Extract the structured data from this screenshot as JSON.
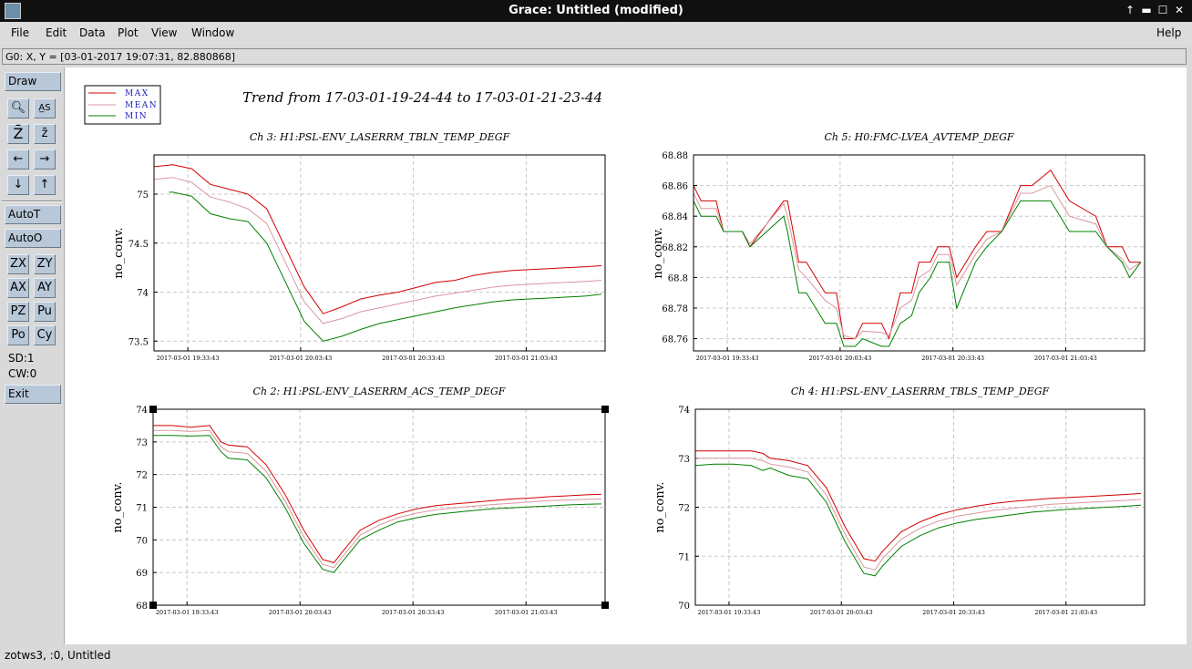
{
  "window": {
    "title": "Grace: Untitled (modified)",
    "controls": [
      "↑",
      "▬",
      "☐",
      "✕"
    ]
  },
  "menu": {
    "items": [
      "File",
      "Edit",
      "Data",
      "Plot",
      "View",
      "Window"
    ],
    "help": "Help"
  },
  "locator": "G0: X, Y = [03-01-2017 19:07:31, 82.880868]",
  "toolbox": {
    "draw": "Draw",
    "autot": "AutoT",
    "autoo": "AutoO",
    "zx": "ZX",
    "zy": "ZY",
    "ax": "AX",
    "ay": "AY",
    "pz": "PZ",
    "pu": "Pu",
    "po": "Po",
    "cy": "Cy",
    "sd": "SD:1",
    "cw": "CW:0",
    "exit": "Exit"
  },
  "status": "zotws3, :0, Untitled",
  "legend": {
    "entries": [
      {
        "name": "MAX",
        "color": "#d40000"
      },
      {
        "name": "MEAN",
        "color": "#d898a0"
      },
      {
        "name": "MIN",
        "color": "#008000"
      }
    ]
  },
  "plot_title": "Trend from 17-03-01-19-24-44 to 17-03-01-21-23-44",
  "chart_data": [
    {
      "type": "line",
      "title": "Ch 3: H1:PSL-ENV_LASERRM_TBLN_TEMP_DEGF",
      "ylabel": "no_conv.",
      "ylim": [
        73.4,
        75.4
      ],
      "yticks": [
        "75",
        "74.5",
        "74",
        "73.5"
      ],
      "xticks": [
        "2017-03-01 19:33:43",
        "2017-03-01 20:03:43",
        "2017-03-01 20:33:43",
        "2017-03-01 21:03:43"
      ],
      "series": [
        {
          "name": "MAX",
          "x": [
            0,
            5,
            10,
            15,
            20,
            25,
            30,
            35,
            40,
            45,
            50,
            55,
            60,
            65,
            70,
            75,
            80,
            85,
            90,
            95,
            100,
            105,
            110,
            115,
            119
          ],
          "values": [
            75.28,
            75.3,
            75.26,
            75.1,
            75.05,
            75.0,
            74.85,
            74.45,
            74.05,
            73.78,
            73.85,
            73.93,
            73.97,
            74.0,
            74.05,
            74.1,
            74.12,
            74.17,
            74.2,
            74.22,
            74.23,
            74.24,
            74.25,
            74.26,
            74.27
          ]
        },
        {
          "name": "MEAN",
          "x": [
            0,
            5,
            10,
            15,
            20,
            25,
            30,
            35,
            40,
            45,
            50,
            55,
            60,
            65,
            70,
            75,
            80,
            85,
            90,
            95,
            100,
            105,
            110,
            115,
            119
          ],
          "values": [
            75.15,
            75.17,
            75.12,
            74.97,
            74.92,
            74.85,
            74.7,
            74.3,
            73.9,
            73.68,
            73.73,
            73.8,
            73.84,
            73.88,
            73.92,
            73.96,
            73.99,
            74.02,
            74.05,
            74.07,
            74.08,
            74.09,
            74.1,
            74.11,
            74.12
          ]
        },
        {
          "name": "MIN",
          "x": [
            4,
            5,
            10,
            15,
            20,
            25,
            30,
            35,
            40,
            45,
            50,
            55,
            60,
            65,
            70,
            75,
            80,
            85,
            90,
            95,
            100,
            105,
            110,
            115,
            119
          ],
          "values": [
            75.02,
            75.02,
            74.98,
            74.8,
            74.75,
            74.72,
            74.5,
            74.1,
            73.7,
            73.5,
            73.55,
            73.62,
            73.68,
            73.72,
            73.76,
            73.8,
            73.84,
            73.87,
            73.9,
            73.92,
            73.93,
            73.94,
            73.95,
            73.96,
            73.98
          ]
        }
      ]
    },
    {
      "type": "line",
      "title": "Ch 5: H0:FMC-LVEA_AVTEMP_DEGF",
      "ylabel": "no_conv.",
      "ylim": [
        68.752,
        68.88
      ],
      "yticks": [
        "68.88",
        "68.86",
        "68.84",
        "68.82",
        "68.8",
        "68.78",
        "68.76"
      ],
      "xticks": [
        "2017-03-01 19:33:43",
        "2017-03-01 20:03:43",
        "2017-03-01 20:33:43",
        "2017-03-01 21:03:43"
      ],
      "series": [
        {
          "name": "MAX",
          "x": [
            0,
            2,
            6,
            8,
            13,
            15,
            24,
            25,
            28,
            30,
            35,
            38,
            40,
            43,
            45,
            50,
            52,
            55,
            58,
            60,
            63,
            65,
            68,
            70,
            75,
            78,
            82,
            87,
            90,
            95,
            100,
            107,
            110,
            114,
            116,
            119
          ],
          "values": [
            68.86,
            68.85,
            68.85,
            68.83,
            68.83,
            68.82,
            68.85,
            68.85,
            68.81,
            68.81,
            68.79,
            68.79,
            68.76,
            68.76,
            68.77,
            68.77,
            68.76,
            68.79,
            68.79,
            68.81,
            68.81,
            68.82,
            68.82,
            68.8,
            68.82,
            68.83,
            68.83,
            68.86,
            68.86,
            68.87,
            68.85,
            68.84,
            68.82,
            68.82,
            68.81,
            68.81
          ]
        },
        {
          "name": "MEAN",
          "x": [
            0,
            2,
            6,
            8,
            13,
            15,
            24,
            25,
            28,
            30,
            35,
            38,
            40,
            43,
            45,
            50,
            52,
            55,
            58,
            60,
            63,
            65,
            68,
            70,
            75,
            78,
            82,
            87,
            90,
            95,
            100,
            107,
            110,
            114,
            116,
            119
          ],
          "values": [
            68.855,
            68.845,
            68.845,
            68.83,
            68.83,
            68.822,
            68.848,
            68.84,
            68.805,
            68.8,
            68.785,
            68.78,
            68.762,
            68.76,
            68.765,
            68.764,
            68.762,
            68.78,
            68.785,
            68.8,
            68.805,
            68.815,
            68.815,
            68.795,
            68.815,
            68.825,
            68.83,
            68.855,
            68.855,
            68.86,
            68.84,
            68.835,
            68.82,
            68.812,
            68.805,
            68.81
          ]
        },
        {
          "name": "MIN",
          "x": [
            0,
            2,
            6,
            8,
            13,
            15,
            24,
            25,
            28,
            30,
            35,
            38,
            40,
            43,
            45,
            50,
            52,
            55,
            58,
            60,
            63,
            65,
            68,
            70,
            75,
            78,
            82,
            87,
            90,
            95,
            100,
            107,
            110,
            114,
            116,
            119
          ],
          "values": [
            68.85,
            68.84,
            68.84,
            68.83,
            68.83,
            68.82,
            68.84,
            68.83,
            68.79,
            68.79,
            68.77,
            68.77,
            68.755,
            68.755,
            68.76,
            68.755,
            68.755,
            68.77,
            68.775,
            68.79,
            68.8,
            68.81,
            68.81,
            68.78,
            68.81,
            68.82,
            68.83,
            68.85,
            68.85,
            68.85,
            68.83,
            68.83,
            68.82,
            68.81,
            68.8,
            68.81
          ]
        }
      ]
    },
    {
      "type": "line",
      "title": "Ch 2: H1:PSL-ENV_LASERRM_ACS_TEMP_DEGF",
      "ylabel": "no_conv.",
      "ylim": [
        68,
        74
      ],
      "yticks": [
        "74",
        "73",
        "72",
        "71",
        "70",
        "69",
        "68"
      ],
      "xticks": [
        "2017-03-01 19:33:43",
        "2017-03-01 20:03:43",
        "2017-03-01 20:33:43",
        "2017-03-01 21:03:43"
      ],
      "series": [
        {
          "name": "MAX",
          "x": [
            0,
            5,
            10,
            15,
            18,
            20,
            25,
            30,
            35,
            40,
            45,
            48,
            50,
            55,
            60,
            65,
            70,
            75,
            80,
            85,
            90,
            95,
            100,
            105,
            110,
            115,
            119
          ],
          "values": [
            73.5,
            73.5,
            73.45,
            73.5,
            73.0,
            72.9,
            72.85,
            72.3,
            71.4,
            70.3,
            69.4,
            69.3,
            69.6,
            70.3,
            70.6,
            70.8,
            70.95,
            71.05,
            71.1,
            71.15,
            71.2,
            71.25,
            71.28,
            71.32,
            71.35,
            71.38,
            71.4
          ]
        },
        {
          "name": "MEAN",
          "x": [
            0,
            5,
            10,
            15,
            18,
            20,
            25,
            30,
            35,
            40,
            45,
            48,
            50,
            55,
            60,
            65,
            70,
            75,
            80,
            85,
            90,
            95,
            100,
            105,
            110,
            115,
            119
          ],
          "values": [
            73.35,
            73.35,
            73.32,
            73.35,
            72.85,
            72.7,
            72.65,
            72.1,
            71.2,
            70.1,
            69.25,
            69.15,
            69.45,
            70.15,
            70.45,
            70.68,
            70.82,
            70.92,
            70.98,
            71.03,
            71.08,
            71.12,
            71.16,
            71.2,
            71.22,
            71.24,
            71.26
          ]
        },
        {
          "name": "MIN",
          "x": [
            0,
            5,
            10,
            15,
            18,
            20,
            25,
            30,
            35,
            40,
            45,
            48,
            50,
            55,
            60,
            65,
            70,
            75,
            80,
            85,
            90,
            95,
            100,
            105,
            110,
            115,
            119
          ],
          "values": [
            73.2,
            73.2,
            73.18,
            73.2,
            72.7,
            72.5,
            72.45,
            71.9,
            71.0,
            69.9,
            69.1,
            69.0,
            69.3,
            70.0,
            70.3,
            70.55,
            70.68,
            70.78,
            70.84,
            70.9,
            70.95,
            70.98,
            71.01,
            71.04,
            71.07,
            71.09,
            71.1
          ]
        }
      ]
    },
    {
      "type": "line",
      "title": "Ch 4: H1:PSL-ENV_LASERRM_TBLS_TEMP_DEGF",
      "ylabel": "no_conv.",
      "ylim": [
        70,
        74
      ],
      "yticks": [
        "74",
        "73",
        "72",
        "71",
        "70"
      ],
      "xticks": [
        "2017-03-01 19:33:43",
        "2017-03-01 20:03:43",
        "2017-03-01 20:33:43",
        "2017-03-01 21:03:43"
      ],
      "series": [
        {
          "name": "MAX",
          "x": [
            0,
            5,
            10,
            15,
            18,
            20,
            25,
            30,
            35,
            40,
            45,
            48,
            50,
            55,
            60,
            65,
            70,
            75,
            80,
            85,
            90,
            95,
            100,
            105,
            110,
            115,
            119
          ],
          "values": [
            73.15,
            73.15,
            73.15,
            73.15,
            73.1,
            73.0,
            72.95,
            72.85,
            72.4,
            71.6,
            70.95,
            70.9,
            71.1,
            71.5,
            71.7,
            71.85,
            71.95,
            72.02,
            72.08,
            72.12,
            72.15,
            72.18,
            72.2,
            72.22,
            72.24,
            72.26,
            72.28
          ]
        },
        {
          "name": "MEAN",
          "x": [
            0,
            5,
            10,
            15,
            18,
            20,
            25,
            30,
            35,
            40,
            45,
            48,
            50,
            55,
            60,
            65,
            70,
            75,
            80,
            85,
            90,
            95,
            100,
            105,
            110,
            115,
            119
          ],
          "values": [
            73.0,
            73.0,
            73.0,
            73.0,
            72.95,
            72.88,
            72.82,
            72.72,
            72.25,
            71.45,
            70.78,
            70.72,
            70.95,
            71.35,
            71.57,
            71.72,
            71.82,
            71.88,
            71.94,
            71.98,
            72.02,
            72.06,
            72.08,
            72.1,
            72.12,
            72.14,
            72.16
          ]
        },
        {
          "name": "MIN",
          "x": [
            0,
            5,
            10,
            15,
            18,
            20,
            25,
            30,
            35,
            40,
            45,
            48,
            50,
            55,
            60,
            65,
            70,
            75,
            80,
            85,
            90,
            95,
            100,
            105,
            110,
            115,
            119
          ],
          "values": [
            72.85,
            72.88,
            72.88,
            72.85,
            72.75,
            72.8,
            72.65,
            72.58,
            72.1,
            71.3,
            70.65,
            70.6,
            70.8,
            71.2,
            71.42,
            71.58,
            71.68,
            71.75,
            71.8,
            71.85,
            71.9,
            71.93,
            71.96,
            71.98,
            72.0,
            72.02,
            72.04
          ]
        }
      ]
    }
  ]
}
